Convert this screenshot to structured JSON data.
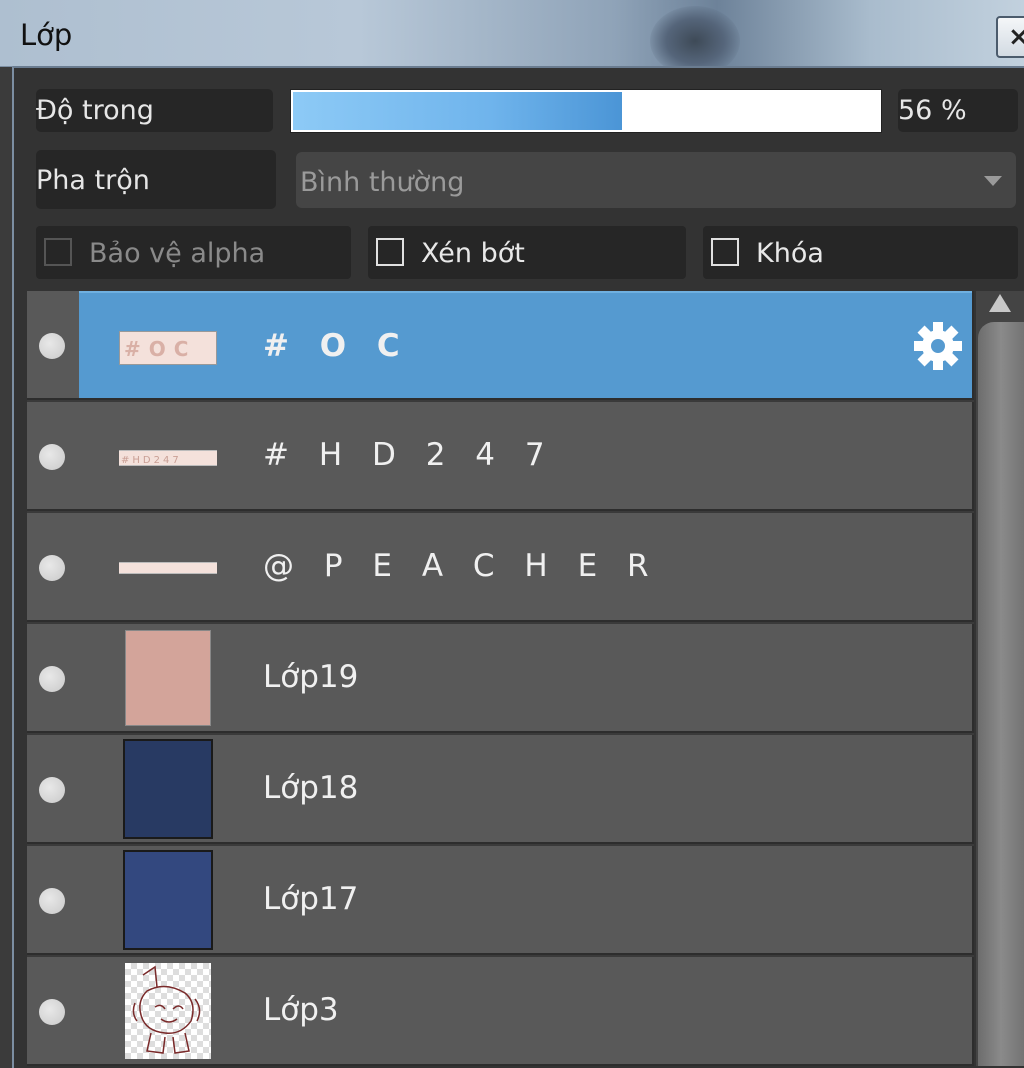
{
  "window": {
    "title": "Lớp",
    "close_label": "×"
  },
  "controls": {
    "opacity_label": "Độ trong",
    "opacity_value_text": "56 %",
    "opacity_fraction": 0.56,
    "blend_label": "Pha trộn",
    "blend_value": "Bình thường",
    "checkboxes": [
      {
        "label": "Bảo vệ alpha",
        "checked": false,
        "enabled": false
      },
      {
        "label": "Xén bớt",
        "checked": false,
        "enabled": true
      },
      {
        "label": "Khóa",
        "checked": false,
        "enabled": true
      }
    ]
  },
  "layers": [
    {
      "name": "# O C",
      "selected": true,
      "visible": true,
      "thumb": "text-oc",
      "color": "#f3d8d0",
      "has_settings": true
    },
    {
      "name": "# H D 2 4 7",
      "selected": false,
      "visible": true,
      "thumb": "text-strip",
      "color": "#f3d8d0"
    },
    {
      "name": "@ P E A C H E R",
      "selected": false,
      "visible": true,
      "thumb": "text-strip-thin",
      "color": "#f3d8d0"
    },
    {
      "name": "Lớp19",
      "selected": false,
      "visible": true,
      "thumb": "swatch",
      "color": "#d3a49a"
    },
    {
      "name": "Lớp18",
      "selected": false,
      "visible": true,
      "thumb": "swatch",
      "color": "#283a63"
    },
    {
      "name": "Lớp17",
      "selected": false,
      "visible": true,
      "thumb": "swatch",
      "color": "#33487f"
    },
    {
      "name": "Lớp3",
      "selected": false,
      "visible": true,
      "thumb": "sketch",
      "color": "#7a2a2a"
    }
  ],
  "colors": {
    "selected_row": "#559ad0",
    "row_bg": "#595959",
    "accent_slider": "#6fb4ec"
  },
  "icons": {
    "settings": "gear-icon",
    "visibility": "visibility-dot-icon"
  }
}
